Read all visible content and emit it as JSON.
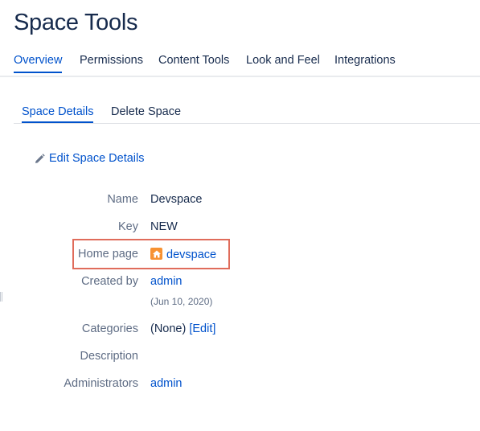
{
  "page": {
    "title": "Space Tools"
  },
  "main_tabs": [
    {
      "label": "Overview",
      "active": true
    },
    {
      "label": "Permissions"
    },
    {
      "label": "Content Tools"
    },
    {
      "label": "Look and Feel"
    },
    {
      "label": "Integrations"
    }
  ],
  "sub_tabs": [
    {
      "label": "Space Details",
      "active": true
    },
    {
      "label": "Delete Space"
    }
  ],
  "edit_link": {
    "label": "Edit Space Details",
    "icon": "pencil-icon"
  },
  "details": {
    "name": {
      "label": "Name",
      "value": "Devspace"
    },
    "key": {
      "label": "Key",
      "value": "NEW"
    },
    "home_page": {
      "label": "Home page",
      "value": "devspace",
      "icon": "home-page-icon"
    },
    "created_by": {
      "label": "Created by",
      "value": "admin",
      "date": "(Jun 10, 2020)"
    },
    "categories": {
      "label": "Categories",
      "value": "(None)",
      "edit_label": "[Edit]"
    },
    "description": {
      "label": "Description",
      "value": ""
    },
    "administrators": {
      "label": "Administrators",
      "value": "admin"
    }
  },
  "colors": {
    "link": "#0052cc",
    "text": "#172b4d",
    "label": "#5e6c84",
    "highlight": "#e06c5b",
    "home_icon": "#f79232"
  }
}
